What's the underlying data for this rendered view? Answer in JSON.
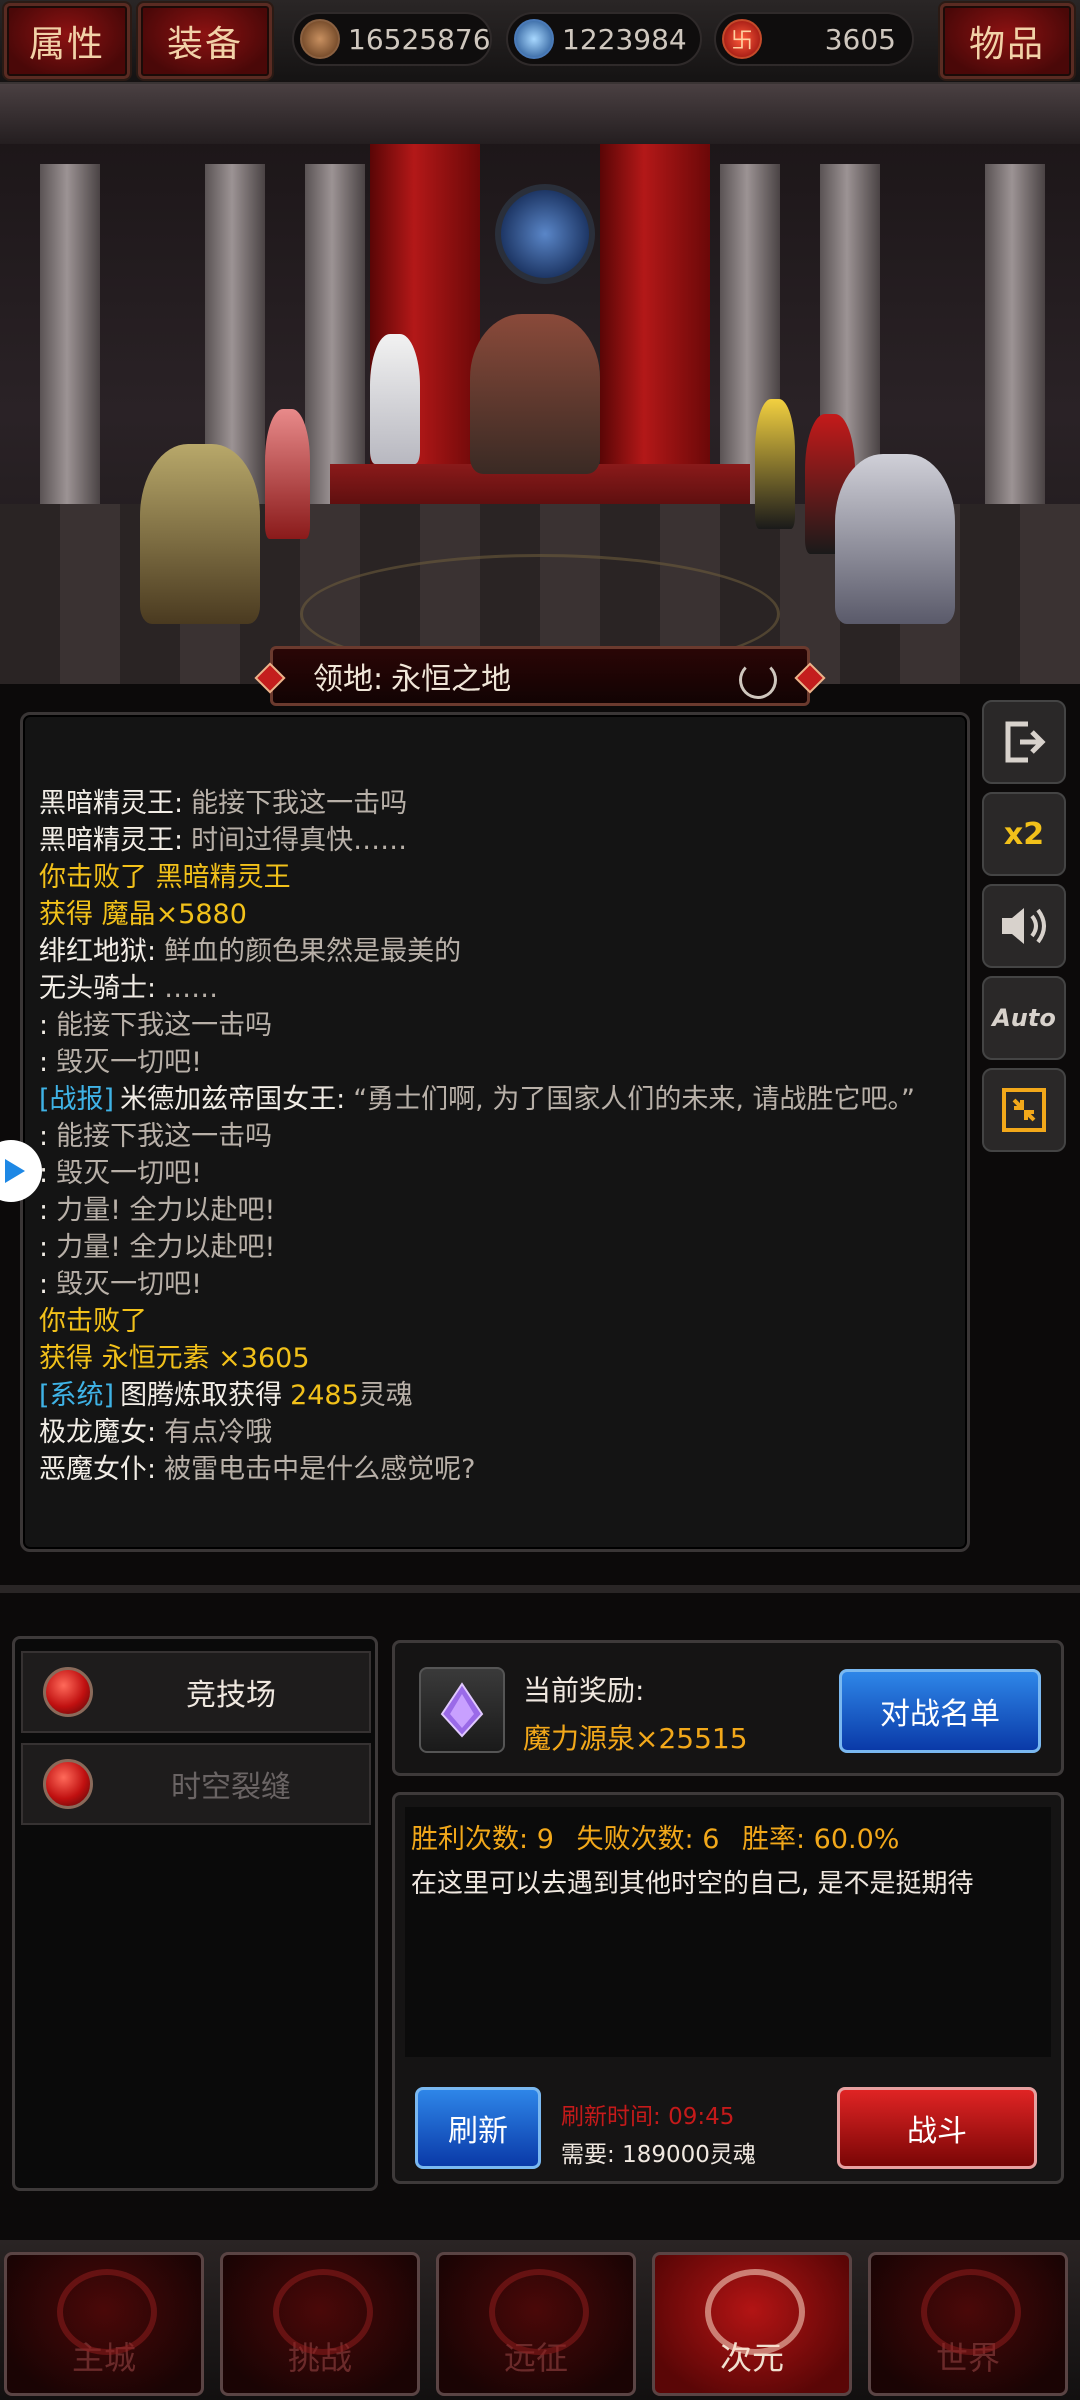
{
  "topbar": {
    "attr_label": "属性",
    "equip_label": "装备",
    "items_label": "物品",
    "resources": [
      {
        "icon": "bronze-coin-icon",
        "value": "16525876"
      },
      {
        "icon": "blue-orb-icon",
        "value": "1223984"
      },
      {
        "icon": "red-rune-icon",
        "value": "3605"
      }
    ]
  },
  "territory": {
    "label": "领地:",
    "name": "永恒之地"
  },
  "log": [
    {
      "who": "黑暗精灵王:",
      "msg": "能接下我这一击吗"
    },
    {
      "who": "黑暗精灵王:",
      "msg": "时间过得真快……"
    },
    {
      "gold": "你击败了 黑暗精灵王"
    },
    {
      "gold": "获得 魔晶×5880"
    },
    {
      "who": "绯红地狱:",
      "msg": "鲜血的颜色果然是最美的"
    },
    {
      "who": "无头骑士:",
      "msg": "……"
    },
    {
      "who": ":",
      "msg": "能接下我这一击吗"
    },
    {
      "who": ":",
      "msg": "毁灭一切吧!"
    },
    {
      "tag": "[战报]",
      "who": "米德加兹帝国女王:",
      "msg": "“勇士们啊, 为了国家人们的未来, 请战胜它吧。”"
    },
    {
      "who": ":",
      "msg": "能接下我这一击吗"
    },
    {
      "who": ":",
      "msg": "毁灭一切吧!"
    },
    {
      "who": ":",
      "msg": "力量! 全力以赴吧!"
    },
    {
      "who": ":",
      "msg": "力量! 全力以赴吧!"
    },
    {
      "who": ":",
      "msg": "毁灭一切吧!"
    },
    {
      "gold": "你击败了"
    },
    {
      "gold": "获得 永恒元素 ×3605"
    },
    {
      "tag": "[系统]",
      "who": "图腾炼取获得",
      "gold": "2485",
      "msg": "灵魂"
    },
    {
      "who": "极龙魔女:",
      "msg": "有点冷哦"
    },
    {
      "who": "恶魔女仆:",
      "msg": "被雷电击中是什么感觉呢?"
    }
  ],
  "side_buttons": {
    "speed_label": "x2",
    "auto_label": "Auto"
  },
  "modes": [
    {
      "label": "竞技场",
      "active": true
    },
    {
      "label": "时空裂缝",
      "active": false
    }
  ],
  "reward": {
    "title": "当前奖励:",
    "item": "魔力源泉×25515",
    "list_button": "对战名单"
  },
  "stats": {
    "win_label": "胜利次数:",
    "win_value": "9",
    "loss_label": "失败次数:",
    "loss_value": "6",
    "rate_label": "胜率:",
    "rate_value": "60.0%",
    "description": "在这里可以去遇到其他时空的自己, 是不是挺期待"
  },
  "actions": {
    "refresh_button": "刷新",
    "refresh_time_label": "刷新时间:",
    "refresh_time": "09:45",
    "cost_label": "需要:",
    "cost_value": "189000灵魂",
    "fight_button": "战斗"
  },
  "nav": [
    {
      "label": "主城",
      "active": false
    },
    {
      "label": "挑战",
      "active": false
    },
    {
      "label": "远征",
      "active": false
    },
    {
      "label": "次元",
      "active": true
    },
    {
      "label": "世界",
      "active": false
    }
  ],
  "colors": {
    "accent_red": "#b31414",
    "gold_text": "#f2c11a",
    "tag_blue": "#3fb3e6",
    "button_blue": "#1a5fd0"
  }
}
